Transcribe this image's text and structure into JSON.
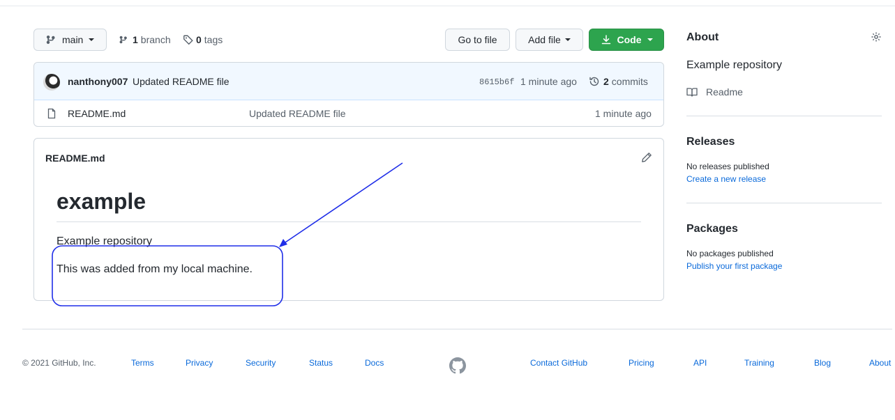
{
  "repo_toolbar": {
    "branch_name": "main",
    "branch_count": "1",
    "branch_label": "branch",
    "tag_count": "0",
    "tag_label": "tags",
    "go_to_file": "Go to file",
    "add_file": "Add file",
    "code": "Code"
  },
  "latest_commit": {
    "author": "nanthony007",
    "message": "Updated README file",
    "sha": "8615b6f",
    "time": "1 minute ago",
    "commit_count": "2",
    "commit_label": "commits"
  },
  "files": [
    {
      "icon": "file-icon",
      "name": "README.md",
      "message": "Updated README file",
      "time": "1 minute ago"
    }
  ],
  "readme": {
    "filename": "README.md",
    "heading": "example",
    "paragraphs": [
      "Example repository",
      "This was added from my local machine."
    ]
  },
  "annotation": {
    "color": "#1f2ee8"
  },
  "sidebar": {
    "about_title": "About",
    "description": "Example repository",
    "readme_link": "Readme",
    "releases_title": "Releases",
    "releases_empty": "No releases published",
    "releases_link": "Create a new release",
    "packages_title": "Packages",
    "packages_empty": "No packages published",
    "packages_link": "Publish your first package"
  },
  "footer": {
    "copyright": "© 2021 GitHub, Inc.",
    "links": [
      "Terms",
      "Privacy",
      "Security",
      "Status",
      "Docs",
      "Contact GitHub",
      "Pricing",
      "API",
      "Training",
      "Blog",
      "About"
    ]
  },
  "colors": {
    "accent": "#0969da",
    "code_button": "#2da44e",
    "commit_row": "#f1f8ff"
  }
}
